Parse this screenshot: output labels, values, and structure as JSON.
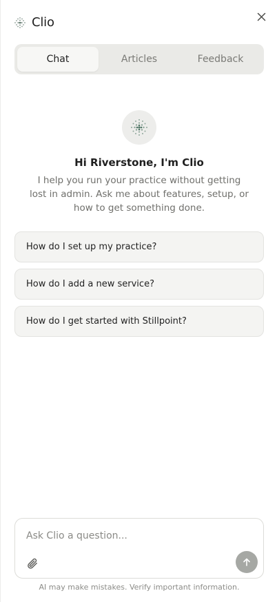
{
  "header": {
    "brand_name": "Clio",
    "brand_icon": "dotted-sphere-icon",
    "close_icon": "close-icon"
  },
  "tabs": [
    {
      "label": "Chat",
      "active": true
    },
    {
      "label": "Articles",
      "active": false
    },
    {
      "label": "Feedback",
      "active": false
    }
  ],
  "welcome": {
    "avatar_icon": "dotted-sphere-icon",
    "greeting": "Hi Riverstone, I'm Clio",
    "intro": "I help you run your practice without getting lost in admin. Ask me about features, setup, or how to get something done."
  },
  "suggestions": [
    {
      "label": "How do I set up my practice?"
    },
    {
      "label": "How do I add a new service?"
    },
    {
      "label": "How do I get started with Stillpoint?"
    }
  ],
  "composer": {
    "placeholder": "Ask Clio a question...",
    "value": "",
    "attach_icon": "paperclip-icon",
    "send_icon": "arrow-up-icon"
  },
  "disclaimer": "AI may make mistakes. Verify important information.",
  "colors": {
    "tab_track": "#eaeae7",
    "suggestion_bg": "#f4f4f2",
    "send_button": "#a6a8a4",
    "icon_green": "#6f8f80"
  }
}
